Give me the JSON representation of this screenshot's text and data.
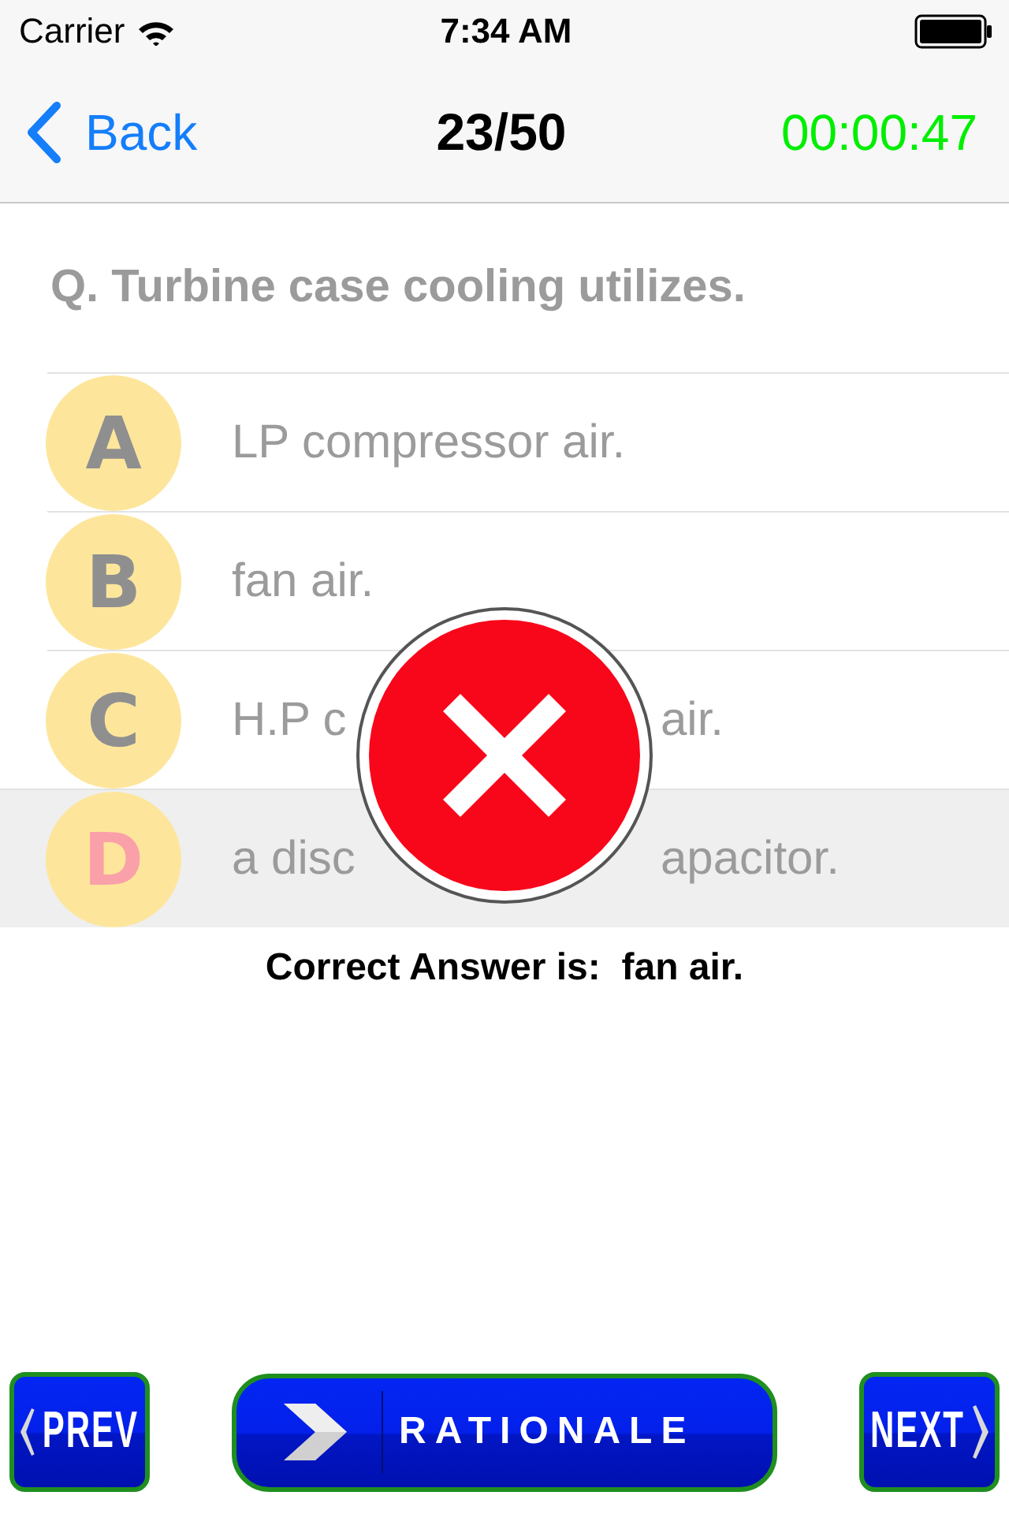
{
  "status_bar": {
    "carrier": "Carrier",
    "time": "7:34 AM"
  },
  "nav_bar": {
    "back": "Back",
    "title": "23/50",
    "timer": "00:00:47"
  },
  "question": "Q. Turbine case cooling utilizes.",
  "options": [
    {
      "letter": "A",
      "text_parts": [
        "LP compressor air."
      ],
      "selected": false
    },
    {
      "letter": "B",
      "text_parts": [
        "fan air."
      ],
      "selected": false
    },
    {
      "letter": "C",
      "text_parts": [
        "H.P c",
        "air."
      ],
      "selected": false
    },
    {
      "letter": "D",
      "text_parts": [
        "a disc",
        "apacitor."
      ],
      "selected": true
    }
  ],
  "feedback": {
    "kind": "incorrect"
  },
  "correct_answer": "Correct Answer is:  fan air.",
  "buttons": {
    "prev": "PREV",
    "rationale": "RATIONALE",
    "next": "NEXT"
  }
}
